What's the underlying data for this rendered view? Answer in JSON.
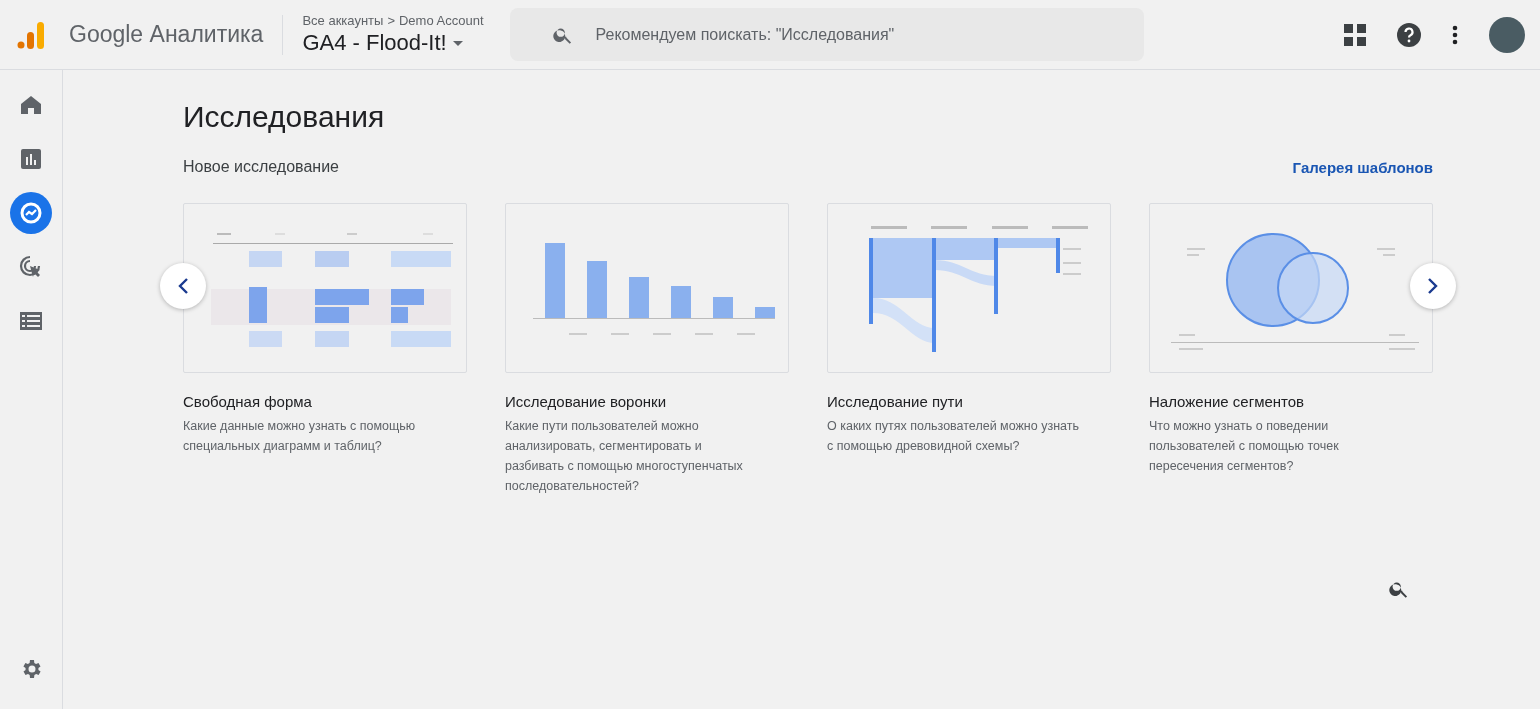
{
  "header": {
    "product": "Google Аналитика",
    "breadcrumb": {
      "root": "Все аккаунты",
      "separator": ">",
      "account": "Demo Account"
    },
    "property": "GA4 - Flood-It!",
    "search": {
      "placeholder": "Рекомендуем поискать: \"Исследования\""
    }
  },
  "sidebar": {
    "items": [
      {
        "kind": "home",
        "selected": false
      },
      {
        "kind": "reports",
        "selected": false
      },
      {
        "kind": "explore",
        "selected": true
      },
      {
        "kind": "advertising",
        "selected": false
      },
      {
        "kind": "configure",
        "selected": false
      }
    ]
  },
  "page": {
    "title": "Исследования",
    "section": "Новое исследование",
    "gallery_link": "Галерея шаблонов",
    "cards": [
      {
        "kind": "freeform",
        "title": "Свободная форма",
        "description": "Какие данные можно узнать с помощью специальных диаграмм и таблиц?"
      },
      {
        "kind": "funnel",
        "title": "Исследование воронки",
        "description": "Какие пути пользователей можно анализировать, сегментировать и разбивать с помощью многоступенчатых последовательностей?"
      },
      {
        "kind": "path",
        "title": "Исследование пути",
        "description": "О каких путях пользователей можно узнать с помощью древовидной схемы?"
      },
      {
        "kind": "overlap",
        "title": "Наложение сегментов",
        "description": "Что можно узнать о поведении пользователей с помощью точек пересечения сегментов?"
      }
    ]
  }
}
